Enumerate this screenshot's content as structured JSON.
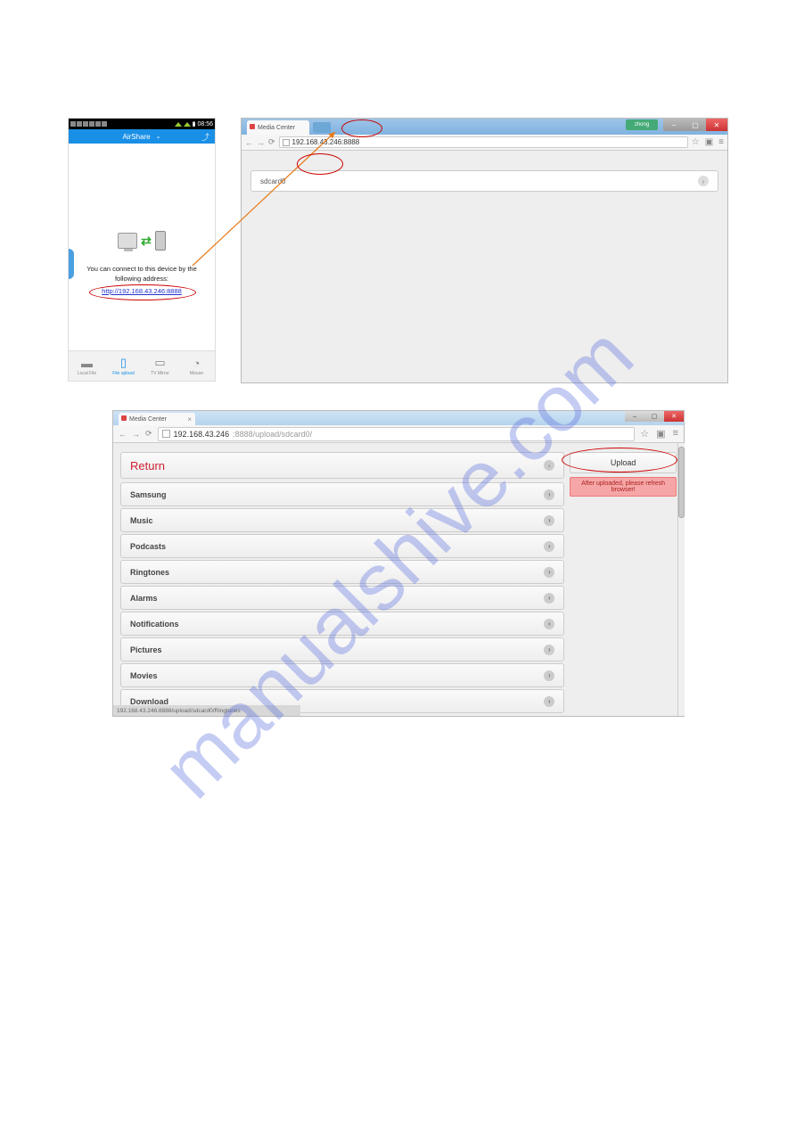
{
  "watermark": "manualshive.com",
  "phone": {
    "time": "08:56",
    "app_title": "AirShare",
    "connect_text_1": "You can connect to this device by the",
    "connect_text_2": "following address:",
    "connect_url": "http://192.168.43.246:8888",
    "nav": [
      "Local File",
      "File upload",
      "TV Mirror",
      "Mouse"
    ]
  },
  "browser1": {
    "tab_title": "Media Center",
    "user_badge": "zhong",
    "url": "192.168.43.246:8888",
    "folder": "sdcard0"
  },
  "browser2": {
    "tab_title": "Media Center",
    "url_host": "192.168.43.246",
    "url_path": ":8888/upload/sdcard0/",
    "return_label": "Return",
    "folders": [
      "Samsung",
      "Music",
      "Podcasts",
      "Ringtones",
      "Alarms",
      "Notifications",
      "Pictures",
      "Movies",
      "Download"
    ],
    "upload_label": "Upload",
    "upload_note": "After uploaded, please refresh browser!",
    "status_url": "192.168.43.246:8888/upload/sdcard0/Ringtones"
  }
}
